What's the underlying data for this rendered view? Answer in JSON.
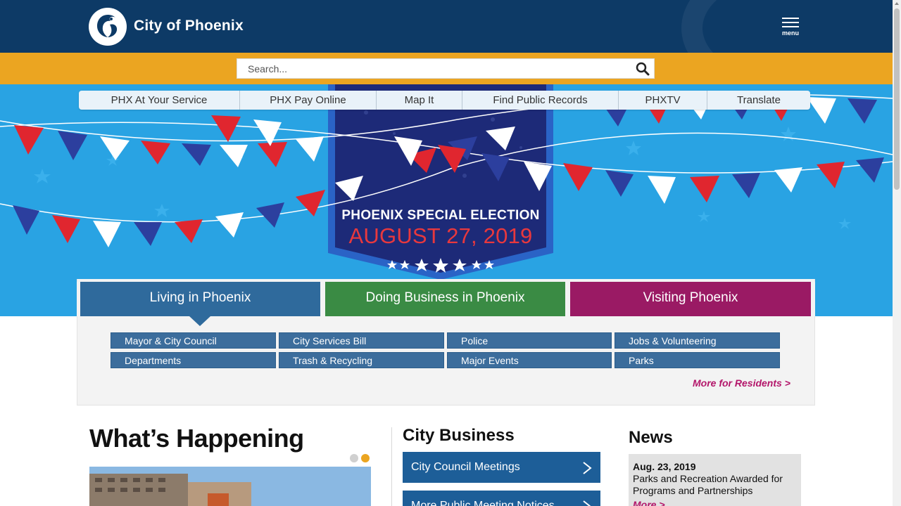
{
  "header": {
    "logo_text": "City of Phoenix",
    "menu_label": "menu"
  },
  "search": {
    "placeholder": "Search..."
  },
  "quicklinks": [
    {
      "label": "PHX At Your Service"
    },
    {
      "label": "PHX Pay Online"
    },
    {
      "label": "Map It"
    },
    {
      "label": "Find Public Records"
    },
    {
      "label": "PHXTV"
    },
    {
      "label": "Translate"
    }
  ],
  "hero": {
    "title": "PHOENIX SPECIAL ELECTION",
    "date": "AUGUST 27, 2019"
  },
  "tabs": {
    "living": "Living in Phoenix",
    "business": "Doing Business in Phoenix",
    "visiting": "Visiting Phoenix"
  },
  "resident_links": [
    "Mayor & City Council",
    "City Services Bill",
    "Police",
    "Jobs & Volunteering",
    "Departments",
    "Trash & Recycling",
    "Major Events",
    "Parks"
  ],
  "more_residents": "More for Residents >",
  "whats_happening": {
    "heading": "What’s Happening"
  },
  "city_business": {
    "heading": "City Business",
    "buttons": [
      "City Council Meetings",
      "More Public Meeting Notices"
    ]
  },
  "news": {
    "heading": "News",
    "date": "Aug. 23, 2019",
    "headline": "Parks and Recreation Awarded for Programs and Partnerships",
    "more": "More >"
  },
  "colors": {
    "header_bg": "#0d3a66",
    "search_band": "#eba521",
    "hero_bg": "#29a3e3",
    "tab_living": "#2f6a9c",
    "tab_business": "#3a8b44",
    "tab_visiting": "#9a1a64",
    "accent_link": "#b3166a"
  }
}
